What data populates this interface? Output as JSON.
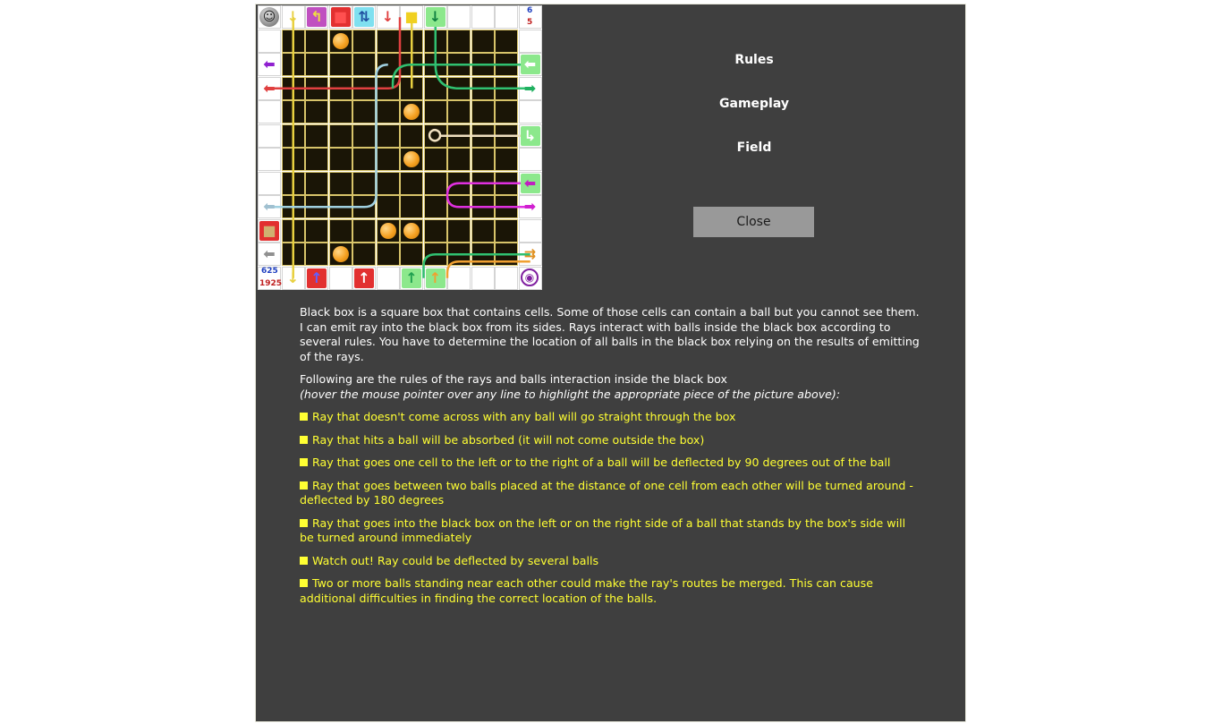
{
  "counters": {
    "top_right_1": "6",
    "top_right_2": "5",
    "bottom_left_1": "625",
    "bottom_left_2": "1925"
  },
  "menu": {
    "rules": "Rules",
    "gameplay": "Gameplay",
    "field": "Field",
    "close": "Close"
  },
  "content": {
    "intro": "Black box is a square box that contains cells. Some of those cells can contain a ball but you cannot see them. I can emit ray into the black box from its sides. Rays interact with balls inside the black box according to several rules. You have to determine the location of all balls in the black box relying on the results of emitting of the rays.",
    "following": "Following are the rules of the rays and balls interaction inside the black box",
    "hover_note": "(hover the mouse pointer over any line to highlight the appropriate piece of the picture above):",
    "rules": [
      "Ray that doesn't come across with any ball will go straight through the box",
      "Ray that hits a ball will be absorbed (it will not come outside the box)",
      "Ray that goes one cell to the left or to the right of a ball will be deflected by 90 degrees out of the ball",
      "Ray that goes between two balls placed at the distance of one cell from each other will be turned around - deflected by 180 degrees",
      "Ray that goes into the black box on the left or on the right side of a ball that stands by the box's side will be turned around immediately",
      "Watch out! Ray could be deflected by several balls",
      "Two or more balls standing near each other could make the ray's routes be merged. This can cause additional difficulties in finding the correct location of the balls."
    ]
  },
  "board": {
    "balls": [
      [
        1,
        3
      ],
      [
        4,
        6
      ],
      [
        6,
        6
      ],
      [
        9,
        5
      ],
      [
        9,
        6
      ],
      [
        10,
        3
      ]
    ],
    "colors": {
      "inner": "#1a1506",
      "grid": "#d8c46a",
      "ball": "#f5a020",
      "yellow_ray": "#e8d040",
      "green_ray": "#30c070",
      "red_ray": "#e04040",
      "purple_ray": "#b030e0",
      "magenta_ray": "#e030e0",
      "cyan_ray": "#a0d0e0",
      "cream_ray": "#f0e0c0",
      "orange_ray": "#f0a030"
    }
  }
}
